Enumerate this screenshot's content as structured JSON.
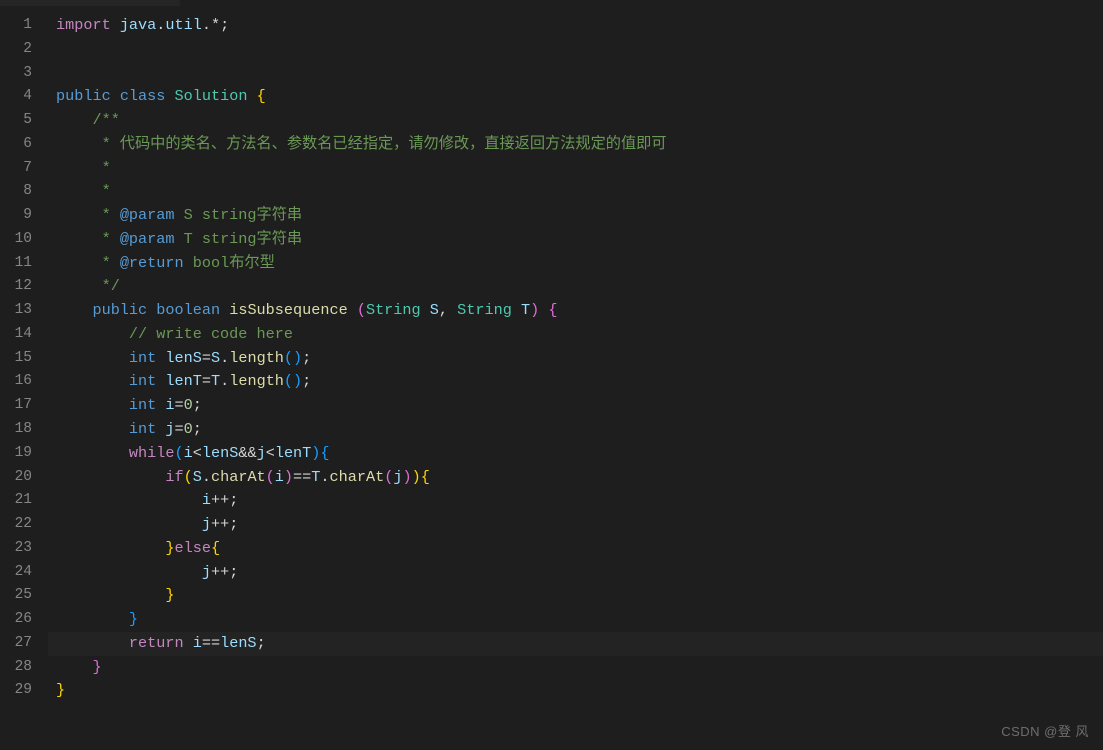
{
  "watermark": "CSDN @登 风",
  "total_lines": 29,
  "highlighted_line": 27,
  "code_lines": [
    {
      "n": 1,
      "indent": 0,
      "tokens": [
        [
          "kr",
          "import"
        ],
        [
          "pn",
          " "
        ],
        [
          "va",
          "java"
        ],
        [
          "pn",
          "."
        ],
        [
          "va",
          "util"
        ],
        [
          "pn",
          ".*;"
        ]
      ]
    },
    {
      "n": 2,
      "indent": 0,
      "tokens": []
    },
    {
      "n": 3,
      "indent": 0,
      "tokens": []
    },
    {
      "n": 4,
      "indent": 0,
      "tokens": [
        [
          "k",
          "public"
        ],
        [
          "pn",
          " "
        ],
        [
          "k",
          "class"
        ],
        [
          "pn",
          " "
        ],
        [
          "cl",
          "Solution"
        ],
        [
          "pn",
          " "
        ],
        [
          "br",
          "{"
        ]
      ]
    },
    {
      "n": 5,
      "indent": 1,
      "tokens": [
        [
          "cm",
          "/**"
        ]
      ]
    },
    {
      "n": 6,
      "indent": 1,
      "tokens": [
        [
          "cm",
          " * 代码中的类名、方法名、参数名已经指定，请勿修改，直接返回方法规定的值即可"
        ]
      ]
    },
    {
      "n": 7,
      "indent": 1,
      "tokens": [
        [
          "cm",
          " *"
        ]
      ]
    },
    {
      "n": 8,
      "indent": 1,
      "tokens": [
        [
          "cm",
          " *"
        ]
      ]
    },
    {
      "n": 9,
      "indent": 1,
      "tokens": [
        [
          "cm",
          " * "
        ],
        [
          "k",
          "@param"
        ],
        [
          "cm",
          " S string字符串"
        ]
      ]
    },
    {
      "n": 10,
      "indent": 1,
      "tokens": [
        [
          "cm",
          " * "
        ],
        [
          "k",
          "@param"
        ],
        [
          "cm",
          " T string字符串"
        ]
      ]
    },
    {
      "n": 11,
      "indent": 1,
      "tokens": [
        [
          "cm",
          " * "
        ],
        [
          "k",
          "@return"
        ],
        [
          "cm",
          " bool布尔型"
        ]
      ]
    },
    {
      "n": 12,
      "indent": 1,
      "tokens": [
        [
          "cm",
          " */"
        ]
      ]
    },
    {
      "n": 13,
      "indent": 1,
      "tokens": [
        [
          "k",
          "public"
        ],
        [
          "pn",
          " "
        ],
        [
          "k",
          "boolean"
        ],
        [
          "pn",
          " "
        ],
        [
          "fn",
          "isSubsequence"
        ],
        [
          "pn",
          " "
        ],
        [
          "br2",
          "("
        ],
        [
          "ty",
          "String"
        ],
        [
          "pn",
          " "
        ],
        [
          "va",
          "S"
        ],
        [
          "pn",
          ", "
        ],
        [
          "ty",
          "String"
        ],
        [
          "pn",
          " "
        ],
        [
          "va",
          "T"
        ],
        [
          "br2",
          ")"
        ],
        [
          "pn",
          " "
        ],
        [
          "br2",
          "{"
        ]
      ]
    },
    {
      "n": 14,
      "indent": 2,
      "tokens": [
        [
          "cm",
          "// write code here"
        ]
      ]
    },
    {
      "n": 15,
      "indent": 2,
      "tokens": [
        [
          "k",
          "int"
        ],
        [
          "pn",
          " "
        ],
        [
          "va",
          "lenS"
        ],
        [
          "op",
          "="
        ],
        [
          "va",
          "S"
        ],
        [
          "pn",
          "."
        ],
        [
          "fn",
          "length"
        ],
        [
          "br3",
          "("
        ],
        [
          "br3",
          ")"
        ],
        [
          "pn",
          ";"
        ]
      ]
    },
    {
      "n": 16,
      "indent": 2,
      "tokens": [
        [
          "k",
          "int"
        ],
        [
          "pn",
          " "
        ],
        [
          "va",
          "lenT"
        ],
        [
          "op",
          "="
        ],
        [
          "va",
          "T"
        ],
        [
          "pn",
          "."
        ],
        [
          "fn",
          "length"
        ],
        [
          "br3",
          "("
        ],
        [
          "br3",
          ")"
        ],
        [
          "pn",
          ";"
        ]
      ]
    },
    {
      "n": 17,
      "indent": 2,
      "tokens": [
        [
          "k",
          "int"
        ],
        [
          "pn",
          " "
        ],
        [
          "va",
          "i"
        ],
        [
          "op",
          "="
        ],
        [
          "nu",
          "0"
        ],
        [
          "pn",
          ";"
        ]
      ]
    },
    {
      "n": 18,
      "indent": 2,
      "tokens": [
        [
          "k",
          "int"
        ],
        [
          "pn",
          " "
        ],
        [
          "va",
          "j"
        ],
        [
          "op",
          "="
        ],
        [
          "nu",
          "0"
        ],
        [
          "pn",
          ";"
        ]
      ]
    },
    {
      "n": 19,
      "indent": 2,
      "tokens": [
        [
          "kr",
          "while"
        ],
        [
          "br3",
          "("
        ],
        [
          "va",
          "i"
        ],
        [
          "op",
          "<"
        ],
        [
          "va",
          "lenS"
        ],
        [
          "op",
          "&&"
        ],
        [
          "va",
          "j"
        ],
        [
          "op",
          "<"
        ],
        [
          "va",
          "lenT"
        ],
        [
          "br3",
          ")"
        ],
        [
          "br3",
          "{"
        ]
      ]
    },
    {
      "n": 20,
      "indent": 3,
      "tokens": [
        [
          "kr",
          "if"
        ],
        [
          "br",
          "("
        ],
        [
          "va",
          "S"
        ],
        [
          "pn",
          "."
        ],
        [
          "fn",
          "charAt"
        ],
        [
          "br2",
          "("
        ],
        [
          "va",
          "i"
        ],
        [
          "br2",
          ")"
        ],
        [
          "op",
          "=="
        ],
        [
          "va",
          "T"
        ],
        [
          "pn",
          "."
        ],
        [
          "fn",
          "charAt"
        ],
        [
          "br2",
          "("
        ],
        [
          "va",
          "j"
        ],
        [
          "br2",
          ")"
        ],
        [
          "br",
          ")"
        ],
        [
          "br",
          "{"
        ]
      ]
    },
    {
      "n": 21,
      "indent": 4,
      "tokens": [
        [
          "va",
          "i"
        ],
        [
          "op",
          "++"
        ],
        [
          "pn",
          ";"
        ]
      ]
    },
    {
      "n": 22,
      "indent": 4,
      "tokens": [
        [
          "va",
          "j"
        ],
        [
          "op",
          "++"
        ],
        [
          "pn",
          ";"
        ]
      ]
    },
    {
      "n": 23,
      "indent": 3,
      "tokens": [
        [
          "br",
          "}"
        ],
        [
          "kr",
          "else"
        ],
        [
          "br",
          "{"
        ]
      ]
    },
    {
      "n": 24,
      "indent": 4,
      "tokens": [
        [
          "va",
          "j"
        ],
        [
          "op",
          "++"
        ],
        [
          "pn",
          ";"
        ]
      ]
    },
    {
      "n": 25,
      "indent": 3,
      "tokens": [
        [
          "br",
          "}"
        ]
      ]
    },
    {
      "n": 26,
      "indent": 2,
      "tokens": [
        [
          "br3",
          "}"
        ]
      ]
    },
    {
      "n": 27,
      "indent": 2,
      "tokens": [
        [
          "kr",
          "return"
        ],
        [
          "pn",
          " "
        ],
        [
          "va",
          "i"
        ],
        [
          "op",
          "=="
        ],
        [
          "va",
          "lenS"
        ],
        [
          "pn",
          ";"
        ]
      ]
    },
    {
      "n": 28,
      "indent": 1,
      "tokens": [
        [
          "br2",
          "}"
        ]
      ]
    },
    {
      "n": 29,
      "indent": 0,
      "tokens": [
        [
          "br",
          "}"
        ]
      ]
    }
  ]
}
